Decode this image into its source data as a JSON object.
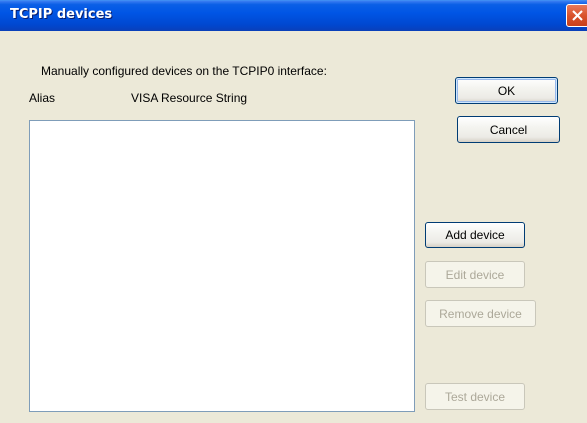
{
  "window": {
    "title": "TCPIP devices"
  },
  "labels": {
    "description": "Manually configured devices on the TCPIP0 interface:",
    "col_alias": "Alias",
    "col_visa": "VISA Resource String"
  },
  "devices": [],
  "buttons": {
    "ok": "OK",
    "cancel": "Cancel",
    "add": "Add device",
    "edit": "Edit device",
    "remove": "Remove device",
    "test": "Test device"
  },
  "colors": {
    "titlebar": "#0055e5",
    "dialog_bg": "#ece9d8",
    "disabled_text": "#aca899"
  }
}
